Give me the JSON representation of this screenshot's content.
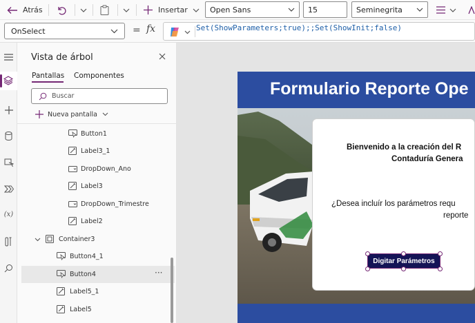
{
  "toolbar": {
    "back_label": "Atrás",
    "insert_label": "Insertar",
    "font_value": "Open Sans",
    "size_value": "15",
    "weight_value": "Seminegrita"
  },
  "formula_bar": {
    "property": "OnSelect",
    "equals": "=",
    "fx": "fx",
    "formula": "Set(ShowParameters;true);;Set(ShowInit;false)"
  },
  "tree_panel": {
    "title": "Vista de árbol",
    "tabs": [
      "Pantallas",
      "Componentes"
    ],
    "search_placeholder": "Buscar",
    "new_screen_label": "Nueva pantalla",
    "items": [
      {
        "label": "Button1",
        "icon": "button-icon"
      },
      {
        "label": "Label3_1",
        "icon": "label-icon"
      },
      {
        "label": "DropDown_Ano",
        "icon": "dropdown-icon"
      },
      {
        "label": "Label3",
        "icon": "label-icon"
      },
      {
        "label": "DropDown_Trimestre",
        "icon": "dropdown-icon"
      },
      {
        "label": "Label2",
        "icon": "label-icon"
      },
      {
        "label": "Container3",
        "icon": "container-icon"
      },
      {
        "label": "Button4_1",
        "icon": "button-icon"
      },
      {
        "label": "Button4",
        "icon": "button-icon"
      },
      {
        "label": "Label5_1",
        "icon": "label-icon"
      },
      {
        "label": "Label5",
        "icon": "label-icon"
      }
    ],
    "more_label": "···"
  },
  "canvas": {
    "header_title": "Formulario Reporte Ope",
    "welcome_line1": "Bienvenido a la creación del R",
    "welcome_line2": "Contaduría Genera",
    "question_line1": "¿Desea incluír los parámetros requ",
    "question_line2": "reporte",
    "button_label": "Digitar Parámetros"
  },
  "colors": {
    "header_bar": "#2c4da0",
    "button_bg": "#141456",
    "accent": "#742774"
  }
}
